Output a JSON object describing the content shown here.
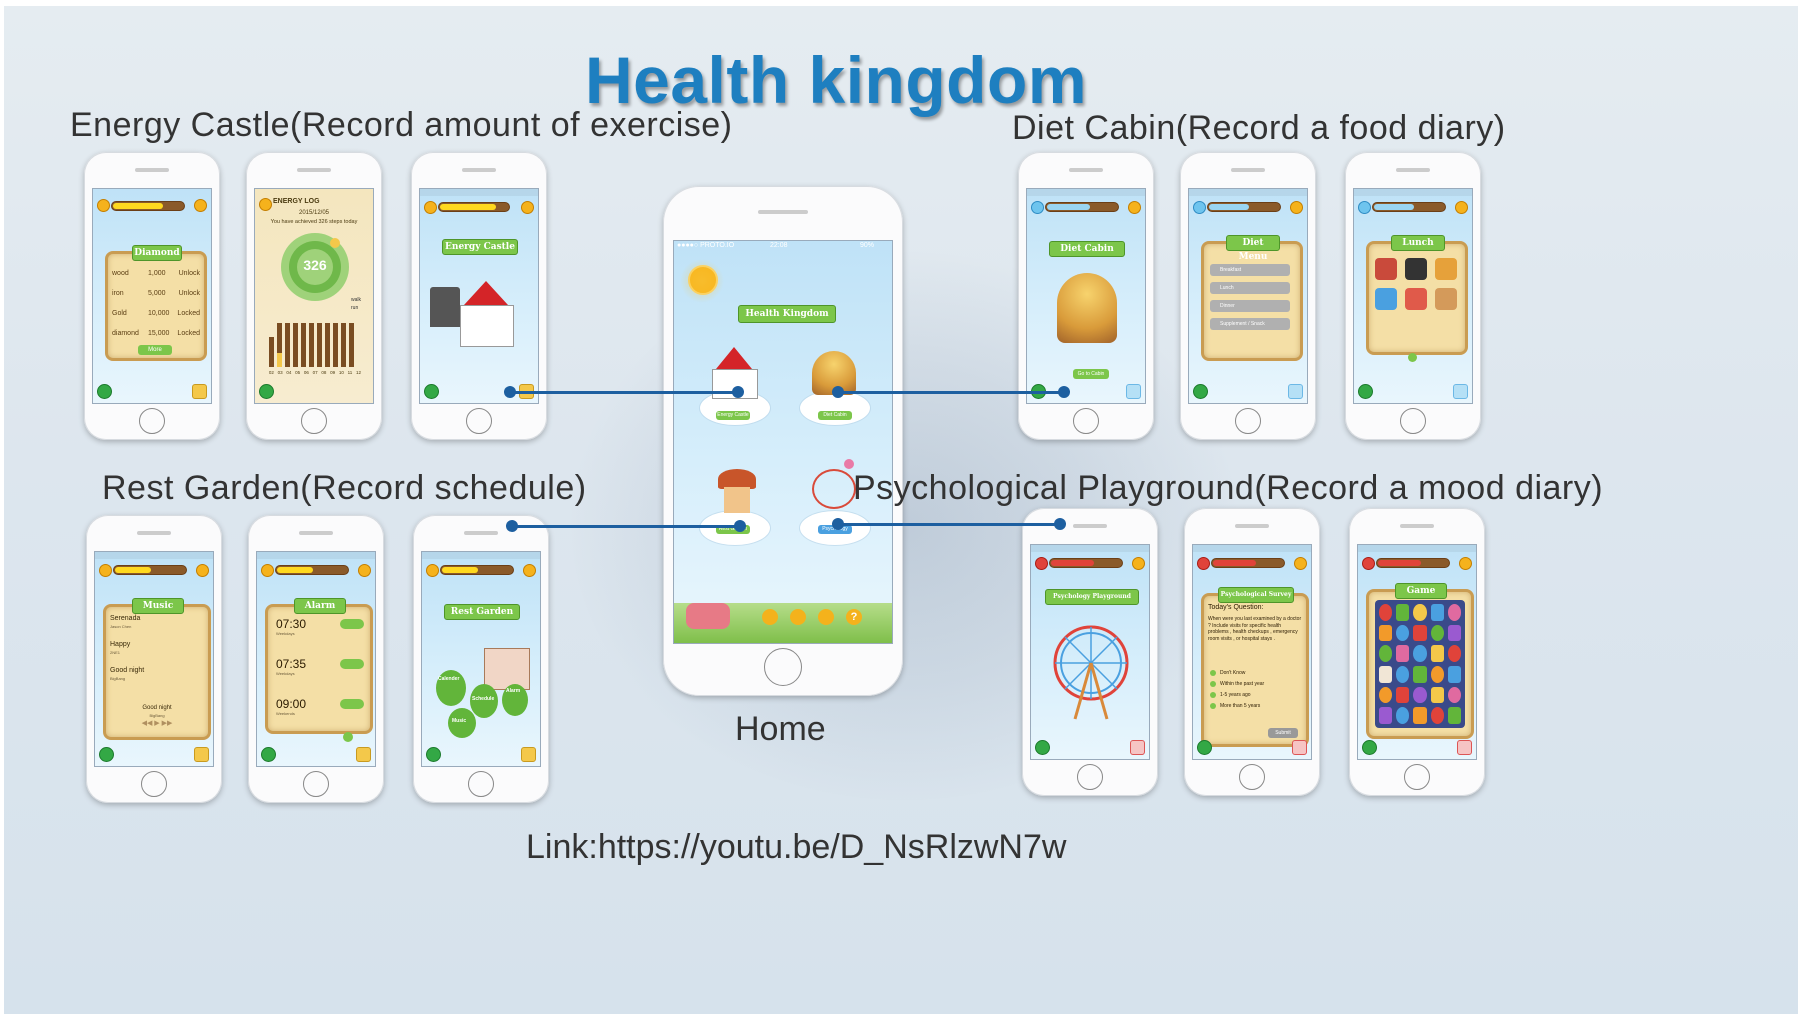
{
  "title": "Health kingdom",
  "sections": {
    "energy": "Energy Castle(Record amount of exercise)",
    "diet": "Diet Cabin(Record a food diary)",
    "rest": "Rest Garden(Record schedule)",
    "psych": "Psychological Playground(Record a mood diary)"
  },
  "home_label": "Home",
  "link_text": "Link:https://youtu.be/D_NsRlzwN7w",
  "home_screen": {
    "status_left": "●●●●○ PROTO.IO",
    "status_time": "22:08",
    "status_right": "90%",
    "banner": "Health Kingdom",
    "buildings": [
      "Energy Castle",
      "Diet Cabin",
      "Rest Garden",
      "Psychology Playground"
    ]
  },
  "energy_screens": {
    "diamond_title": "Diamond",
    "diamond_rows": [
      {
        "name": "wood",
        "value": "1,000",
        "action": "Unlock"
      },
      {
        "name": "iron",
        "value": "5,000",
        "action": "Unlock"
      },
      {
        "name": "Gold",
        "value": "10,000",
        "action": "Locked"
      },
      {
        "name": "diamond",
        "value": "15,000",
        "action": "Locked"
      }
    ],
    "more_button": "More",
    "log_title": "ENERGY LOG",
    "log_date": "2015/12/05",
    "log_message": "You have achieved 326 steps today",
    "steps": "326",
    "legend_walk": "walk",
    "legend_run": "run",
    "log_days": [
      "02",
      "03",
      "04",
      "05",
      "06",
      "07",
      "08",
      "09",
      "10",
      "11",
      "12"
    ],
    "castle_banner": "Energy Castle"
  },
  "diet_screens": {
    "cabin_banner": "Diet Cabin",
    "go_button": "Go to Cabin",
    "menu_title": "Diet Menu",
    "menu_items": [
      "Breakfast",
      "Lunch",
      "Dinner",
      "Supplement / Snack"
    ],
    "lunch_title": "Lunch"
  },
  "rest_screens": {
    "music_title": "Music",
    "songs": [
      {
        "title": "Serenada",
        "artist": "Jason Chen"
      },
      {
        "title": "Happy",
        "artist": "2NE1"
      },
      {
        "title": "Good night",
        "artist": "BigBang"
      }
    ],
    "now_playing": "Good night",
    "now_playing_artist": "BigBang",
    "alarm_title": "Alarm",
    "alarms": [
      {
        "time": "07:30",
        "days": "Weekdays"
      },
      {
        "time": "07:35",
        "days": "Weekdays"
      },
      {
        "time": "09:00",
        "days": "Weekends"
      }
    ],
    "garden_banner": "Rest Garden",
    "tree_labels": [
      "Calender",
      "Schedule",
      "Alarm",
      "Music"
    ]
  },
  "psych_screens": {
    "playground_banner": "Psychology Playground",
    "survey_title": "Psychological Survey",
    "question_heading": "Today's Question:",
    "question_text": "When were you last examined by a doctor ? Include visits for specific health problems , health checkups , emergency room visits , or hospital stays .",
    "options": [
      "Don't Know",
      "Within the past year",
      "1-5 years ago",
      "More than 5 years"
    ],
    "submit": "Submit",
    "game_title": "Game"
  },
  "colors": {
    "title": "#1e7fc0",
    "connector": "#1d5fa0",
    "label_text": "#333333",
    "parchment": "#f4dfa6",
    "ribbon": "#7cc64a",
    "sky": "#bfe2f7"
  }
}
